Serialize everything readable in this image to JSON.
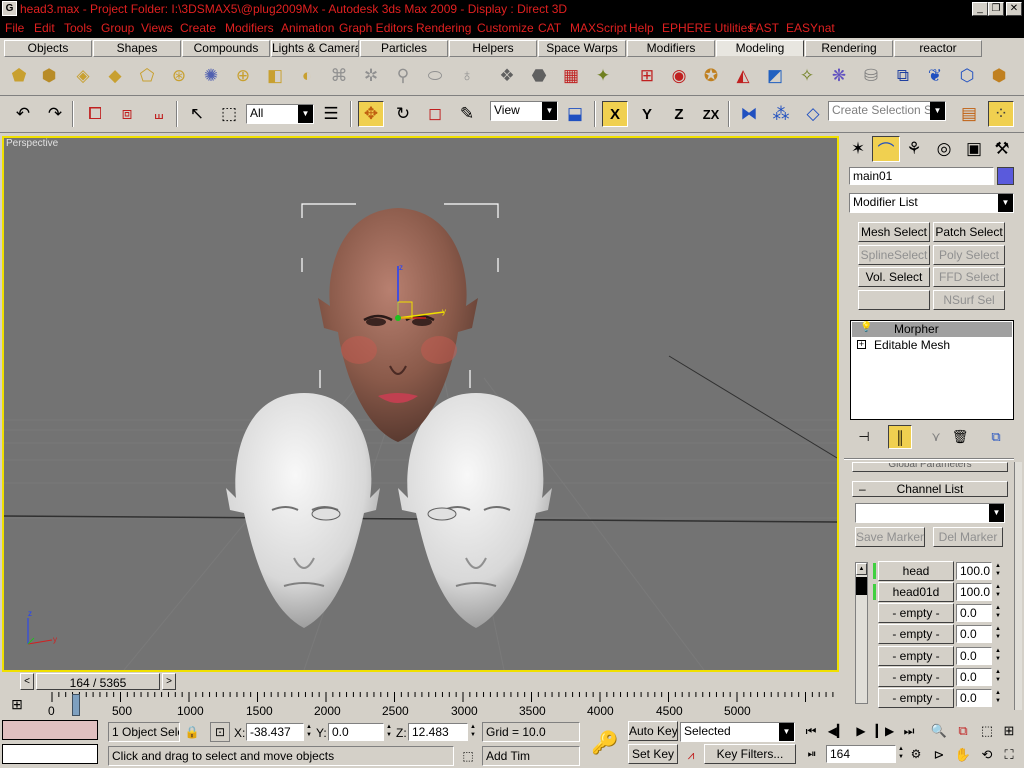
{
  "title": {
    "app_icon": "3ds-max-icon",
    "text": "head3.max     - Project Folder: I:\\3DSMAX5\\@plug2009Mx     - Autodesk 3ds Max  2009          - Display : Direct 3D"
  },
  "menu": [
    "File",
    "Edit",
    "Tools",
    "Group",
    "Views",
    "Create",
    "Modifiers",
    "Animation",
    "Graph Editors",
    "Rendering",
    "Customize",
    "CAT",
    "MAXScript",
    "Help",
    "EPHERE Utilities",
    "FAST",
    "EASYnat"
  ],
  "tabs": [
    "Objects",
    "Shapes",
    "Compounds",
    "Lights & Cameras",
    "Particles",
    "Helpers",
    "Space Warps",
    "Modifiers",
    "Modeling",
    "Rendering",
    "reactor"
  ],
  "active_tab": "Modeling",
  "toolbar2": {
    "selection_filter": "All",
    "ref_coord": "View",
    "axis_x": "X",
    "axis_y": "Y",
    "axis_z": "Z",
    "axis_zx": "ZX",
    "named_selection": "Create Selection Set"
  },
  "viewport": {
    "label": "Perspective",
    "axis_z": "z",
    "axis_y": "y",
    "gizmo_z": "z",
    "gizmo_y": "y"
  },
  "command_panel": {
    "object_name": "main01",
    "object_color": "#5a5adc",
    "modifier_list": "Modifier List",
    "buttons": [
      {
        "label": "Mesh Select",
        "enabled": true
      },
      {
        "label": "Patch Select",
        "enabled": true
      },
      {
        "label": "SplineSelect",
        "enabled": false
      },
      {
        "label": "Poly Select",
        "enabled": false
      },
      {
        "label": "Vol. Select",
        "enabled": true
      },
      {
        "label": "FFD Select",
        "enabled": false
      },
      {
        "label": "",
        "enabled": false
      },
      {
        "label": "NSurf Sel",
        "enabled": false
      }
    ],
    "stack": [
      {
        "label": "Morpher",
        "selected": true
      },
      {
        "label": "Editable Mesh",
        "selected": false
      }
    ],
    "global_params": "Global Parameters",
    "channel_list_title": "Channel List",
    "save_marker": "Save Marker",
    "del_marker": "Del Marker",
    "channels": [
      {
        "name": "head",
        "value": "100.0",
        "active": true
      },
      {
        "name": "head01d",
        "value": "100.0",
        "active": true
      },
      {
        "name": "- empty -",
        "value": "0.0",
        "active": false
      },
      {
        "name": "- empty -",
        "value": "0.0",
        "active": false
      },
      {
        "name": "- empty -",
        "value": "0.0",
        "active": false
      },
      {
        "name": "- empty -",
        "value": "0.0",
        "active": false
      },
      {
        "name": "- empty -",
        "value": "0.0",
        "active": false
      }
    ]
  },
  "timeline": {
    "frame_display": "164 / 5365",
    "ticks": [
      "0",
      "500",
      "1000",
      "1500",
      "2000",
      "2500",
      "3000",
      "3500",
      "4000",
      "4500",
      "5000"
    ]
  },
  "status": {
    "selection": "1 Object Sele",
    "x_label": "X:",
    "x": "-38.437",
    "y_label": "Y:",
    "y": "0.0",
    "z_label": "Z:",
    "z": "12.483",
    "grid": "Grid = 10.0",
    "prompt": "Click and drag to select and move objects",
    "add_time": "Add Tim",
    "auto_key": "Auto Key",
    "set_key": "Set Key",
    "key_mode": "Selected",
    "key_filters": "Key Filters...",
    "frame": "164"
  }
}
